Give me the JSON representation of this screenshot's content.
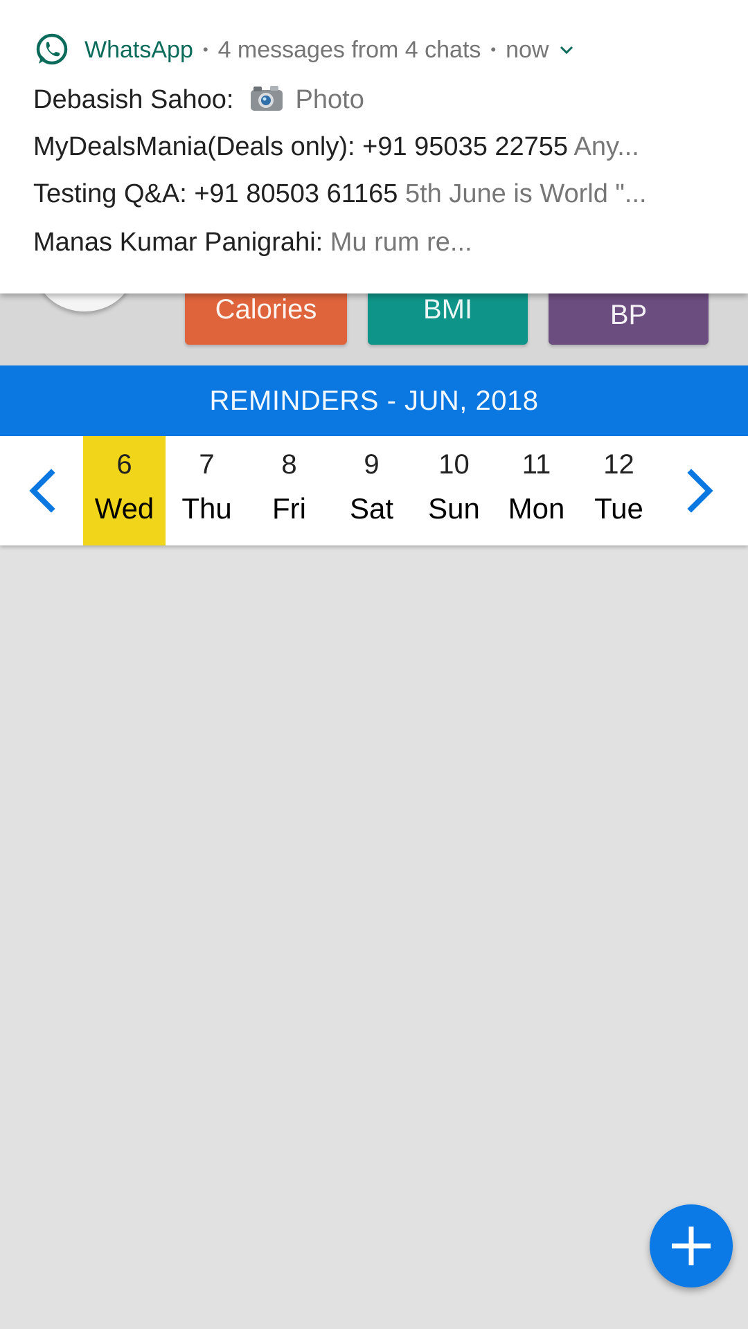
{
  "notification": {
    "app_name": "WhatsApp",
    "summary": "4 messages from 4 chats",
    "time": "now",
    "messages": [
      {
        "sender": "Debasish Sahoo:",
        "icon": "camera-icon",
        "preview": "Photo"
      },
      {
        "sender": "MyDealsMania(Deals only): +91 95035 22755",
        "preview": "Any..."
      },
      {
        "sender": "Testing Q&A: +91 80503 61165",
        "preview": "5th June is World \"..."
      },
      {
        "sender": "Manas Kumar Panigrahi:",
        "preview": "Mu rum re..."
      }
    ]
  },
  "metrics": {
    "calories": "Calories",
    "bmi": "BMI",
    "bp": "BP"
  },
  "reminders": {
    "title": "REMINDERS - JUN, 2018"
  },
  "calendar": {
    "days": [
      {
        "num": "6",
        "name": "Wed"
      },
      {
        "num": "7",
        "name": "Thu"
      },
      {
        "num": "8",
        "name": "Fri"
      },
      {
        "num": "9",
        "name": "Sat"
      },
      {
        "num": "10",
        "name": "Sun"
      },
      {
        "num": "11",
        "name": "Mon"
      },
      {
        "num": "12",
        "name": "Tue"
      }
    ]
  },
  "colors": {
    "accent": "#0b78e2",
    "selected_day": "#f0d51a",
    "calories": "#e0643b",
    "bmi": "#0e9488",
    "bp": "#6c4d7f",
    "whatsapp": "#0b6b5b"
  }
}
